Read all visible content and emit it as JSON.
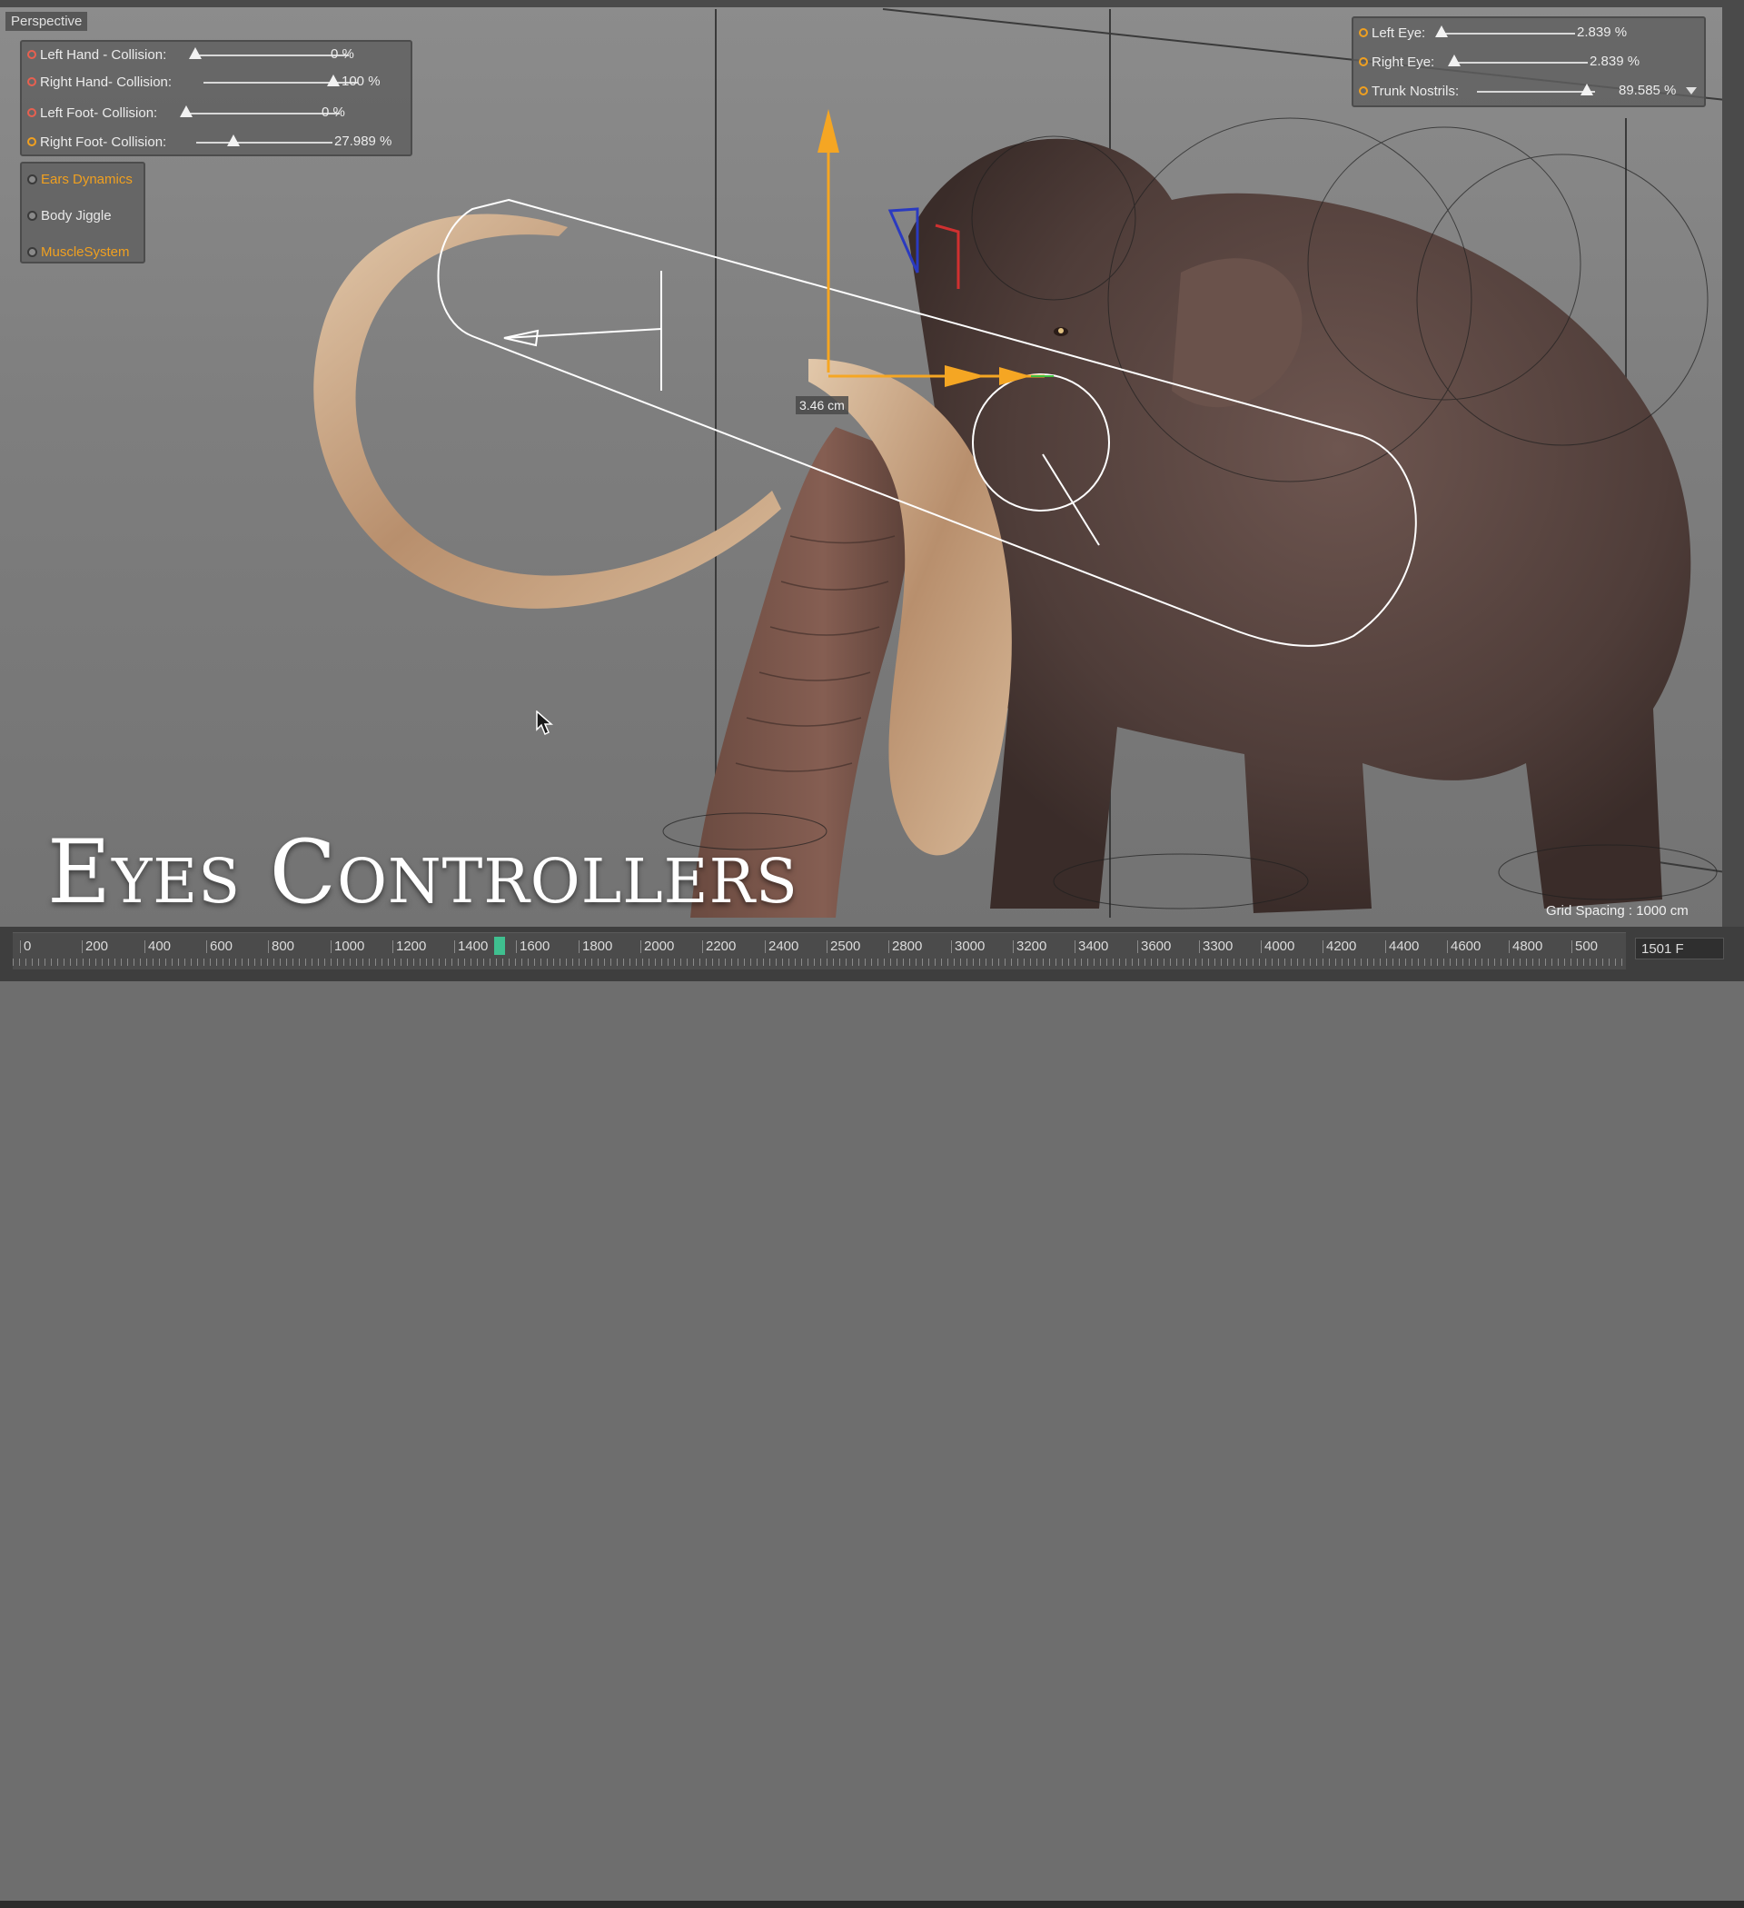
{
  "viewport": {
    "label": "Perspective",
    "measure_label": "3.46 cm",
    "grid_spacing": "Grid Spacing : 1000 cm"
  },
  "collision_panel": {
    "rows": [
      {
        "label": "Left Hand - Collision:",
        "value": "0 %",
        "level": 0.0,
        "status": "red"
      },
      {
        "label": "Right Hand- Collision:",
        "value": "100 %",
        "level": 1.0,
        "status": "red"
      },
      {
        "label": "Left Foot- Collision:",
        "value": "0 %",
        "level": 0.0,
        "status": "red"
      },
      {
        "label": "Right Foot- Collision:",
        "value": "27.989 %",
        "level": 0.28,
        "status": "orange"
      }
    ]
  },
  "dynamics_panel": {
    "items": [
      {
        "label": "Ears Dynamics",
        "color": "#f0a020"
      },
      {
        "label": "Body Jiggle",
        "color": "#e8e8e8"
      },
      {
        "label": "MuscleSystem",
        "color": "#f0a020"
      }
    ]
  },
  "eyes_panel": {
    "rows": [
      {
        "label": "Left Eye:",
        "value": "2.839 %",
        "level": 0.03
      },
      {
        "label": "Right Eye:",
        "value": "2.839 %",
        "level": 0.03
      },
      {
        "label": "Trunk Nostrils:",
        "value": "89.585 %",
        "level": 0.9
      }
    ]
  },
  "overlay": {
    "title": "Eyes Controllers"
  },
  "timeline": {
    "ticks": [
      "0",
      "200",
      "400",
      "600",
      "800",
      "1000",
      "1200",
      "1400",
      "1600",
      "1800",
      "2000",
      "2200",
      "2400",
      "2500",
      "2800",
      "3000",
      "3200",
      "3400",
      "3600",
      "3300",
      "4000",
      "4200",
      "4400",
      "4600",
      "4800",
      "500"
    ],
    "frame": "1501 F",
    "playhead_frame": 1501
  },
  "colors": {
    "accent_orange": "#f0a020",
    "status_red": "#e86050",
    "playhead": "#3fbf8f"
  },
  "icons": [
    "mouse-pointer-icon",
    "red-circle-icon",
    "orange-circle-icon",
    "dropdown-arrow-icon"
  ]
}
